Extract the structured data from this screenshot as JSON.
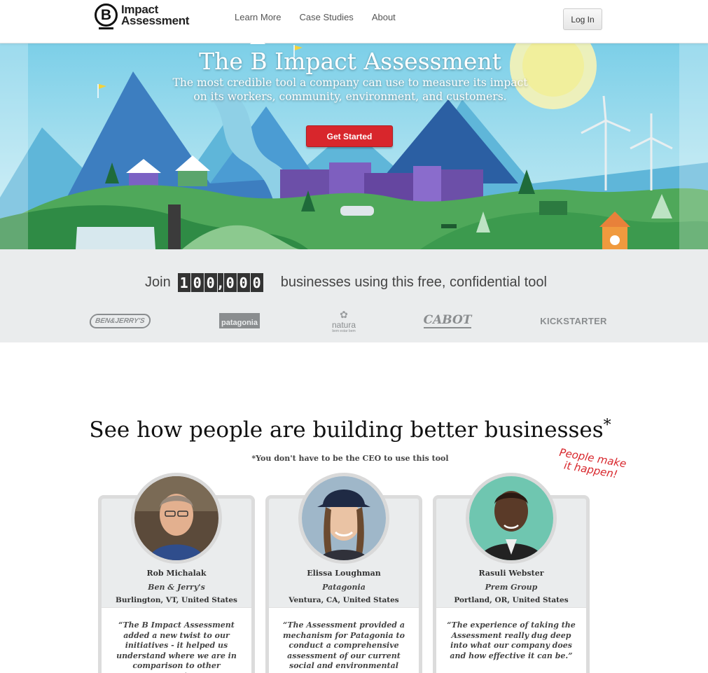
{
  "header": {
    "logo_line1": "Impact",
    "logo_line2": "Assessment",
    "logo_mark": "B",
    "nav": [
      {
        "label": "Learn More"
      },
      {
        "label": "Case Studies"
      },
      {
        "label": "About"
      }
    ],
    "login_label": "Log In"
  },
  "hero": {
    "title": "The B Impact Assessment",
    "subtitle": "The most credible tool a company can use to measure its impact on its workers, community, environment, and customers.",
    "cta_label": "Get Started"
  },
  "join": {
    "prefix": "Join",
    "count_digits": [
      "1",
      "0",
      "0",
      ",",
      "0",
      "0",
      "0"
    ],
    "suffix": "businesses using this free, confidential tool",
    "brands": [
      {
        "name": "BEN&JERRY'S",
        "icon": "ben-and-jerrys-logo"
      },
      {
        "name": "patagonia",
        "icon": "patagonia-logo"
      },
      {
        "name": "natura",
        "tagline": "bem estar bem",
        "icon": "natura-logo"
      },
      {
        "name": "CABOT",
        "icon": "cabot-logo"
      },
      {
        "name": "KICKSTARTER",
        "icon": "kickstarter-logo"
      }
    ]
  },
  "stories": {
    "title": "See how people are building better businesses",
    "title_mark": "*",
    "note": "*You don't have to be the CEO to use this tool",
    "handwritten": "People make it happen!",
    "cards": [
      {
        "name": "Rob Michalak",
        "company": "Ben & Jerry's",
        "location": "Burlington, VT, United States",
        "quote": "“The B Impact Assessment added a new twist to our initiatives - it helped us understand where we are in comparison to other companies.”"
      },
      {
        "name": "Elissa Loughman",
        "company": "Patagonia",
        "location": "Ventura, CA, United States",
        "quote": "“The Assessment provided a mechanism for Patagonia to conduct a comprehensive assessment of our current social and environmental programs.”"
      },
      {
        "name": "Rasuli Webster",
        "company": "Prem Group",
        "location": "Portland, OR, United States",
        "quote": "“The experience of taking the Assessment really dug deep into what our company does and how effective it can be.”"
      }
    ]
  },
  "colors": {
    "cta_red": "#d8262c",
    "band_gray": "#eaeced",
    "counter_bg": "#333333"
  }
}
